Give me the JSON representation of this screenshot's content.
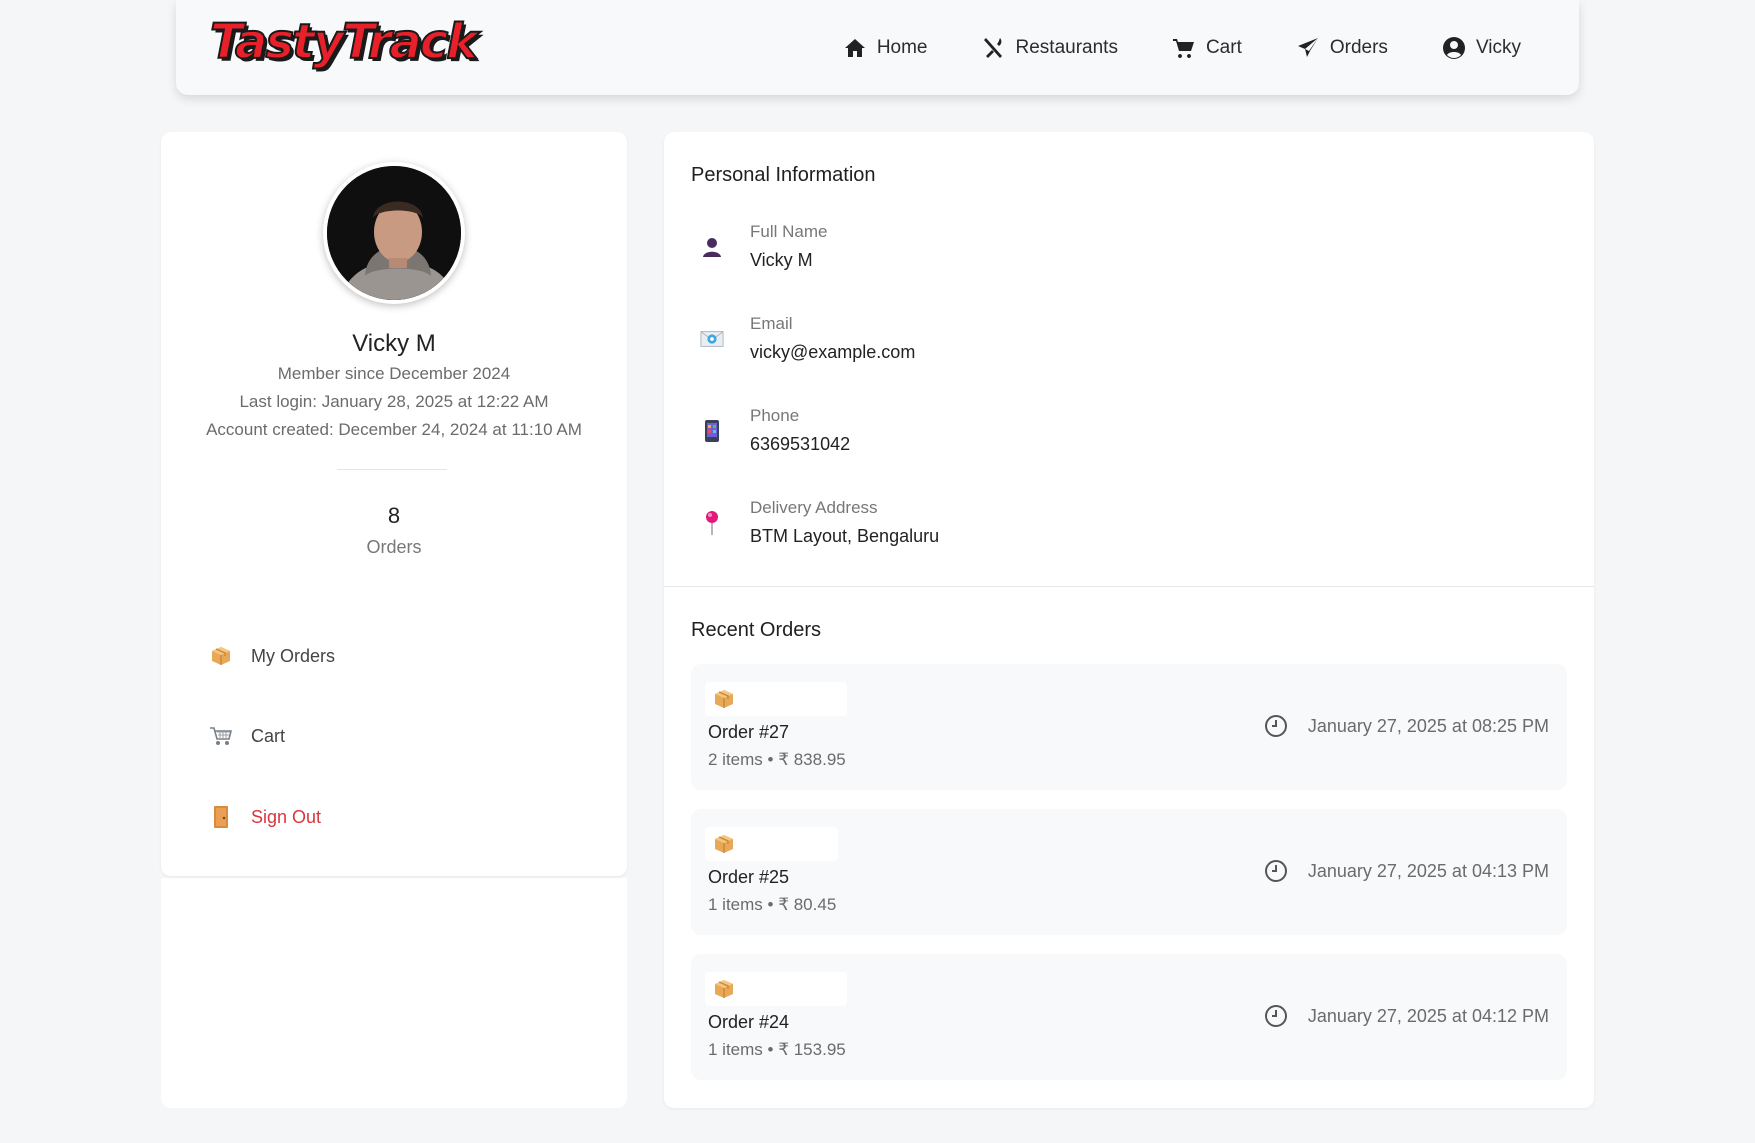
{
  "brand": {
    "logo_text": "TastyTrack"
  },
  "nav": {
    "items": [
      {
        "label": "Home",
        "icon": "home-icon"
      },
      {
        "label": "Restaurants",
        "icon": "utensils-icon"
      },
      {
        "label": "Cart",
        "icon": "cart-icon"
      },
      {
        "label": "Orders",
        "icon": "paper-plane-icon"
      },
      {
        "label": "Vicky",
        "icon": "user-circle-icon"
      }
    ]
  },
  "profile": {
    "name": "Vicky M",
    "member_since": "Member since December 2024",
    "last_login": "Last login: January 28, 2025 at 12:22 AM",
    "account_created": "Account created: December 24, 2024 at 11:10 AM",
    "orders_count": "8",
    "orders_label": "Orders",
    "menu": [
      {
        "label": "My Orders",
        "icon": "package-icon"
      },
      {
        "label": "Cart",
        "icon": "shopping-cart-icon"
      },
      {
        "label": "Sign Out",
        "icon": "door-icon"
      }
    ]
  },
  "personal_info": {
    "title": "Personal Information",
    "fields": [
      {
        "label": "Full Name",
        "value": "Vicky M",
        "icon": "person-icon"
      },
      {
        "label": "Email",
        "value": "vicky@example.com",
        "icon": "envelope-icon"
      },
      {
        "label": "Phone",
        "value": "6369531042",
        "icon": "mobile-phone-icon"
      },
      {
        "label": "Delivery Address",
        "value": "BTM Layout, Bengaluru",
        "icon": "pushpin-icon"
      }
    ]
  },
  "recent_orders": {
    "title": "Recent Orders",
    "orders": [
      {
        "title": "Order #27",
        "summary": "2 items • ₹ 838.95",
        "date": "January 27, 2025 at 08:25 PM"
      },
      {
        "title": "Order #25",
        "summary": "1 items • ₹ 80.45",
        "date": "January 27, 2025 at 04:13 PM"
      },
      {
        "title": "Order #24",
        "summary": "1 items • ₹ 153.95",
        "date": "January 27, 2025 at 04:12 PM"
      }
    ]
  },
  "colors": {
    "accent_danger": "#d9363e",
    "logo_red": "#e8202a"
  }
}
